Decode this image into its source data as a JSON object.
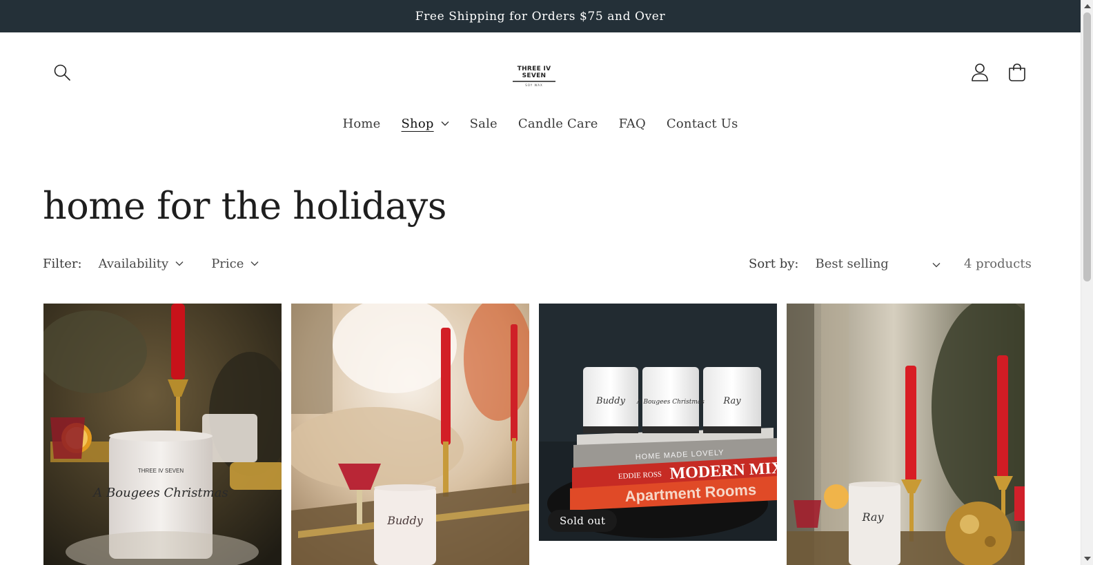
{
  "announcement": {
    "text": "Free Shipping for Orders $75 and Over",
    "bg_color": "#243038"
  },
  "header": {
    "logo": {
      "brand": "THREE IV SEVEN",
      "tagline": "SOY WAX"
    },
    "icons": {
      "search": "search-icon",
      "account": "user-icon",
      "cart": "cart-icon"
    }
  },
  "nav": {
    "items": [
      {
        "label": "Home",
        "active": false,
        "has_dropdown": false
      },
      {
        "label": "Shop",
        "active": true,
        "has_dropdown": true
      },
      {
        "label": "Sale",
        "active": false,
        "has_dropdown": false
      },
      {
        "label": "Candle Care",
        "active": false,
        "has_dropdown": false
      },
      {
        "label": "FAQ",
        "active": false,
        "has_dropdown": false
      },
      {
        "label": "Contact Us",
        "active": false,
        "has_dropdown": false
      }
    ]
  },
  "collection": {
    "title": "home for the holidays"
  },
  "filters": {
    "label": "Filter:",
    "availability": "Availability",
    "price": "Price"
  },
  "sort": {
    "label": "Sort by:",
    "selected": "Best selling"
  },
  "product_count": "4 products",
  "products": [
    {
      "image_alt": "A Bougees Christmas candle on holiday table",
      "label_script": "A Bougees Christmas",
      "sold_out": false
    },
    {
      "image_alt": "Buddy candle on mirrored tray",
      "label_script": "Buddy",
      "sold_out": false
    },
    {
      "image_alt": "Three candles on stack of books",
      "label_script": "Buddy / A Bougees Christmas / Ray",
      "sold_out": true,
      "badge": "Sold out"
    },
    {
      "image_alt": "Ray candle with red taper candles",
      "label_script": "Ray",
      "sold_out": false
    }
  ],
  "book_spines": [
    "HOME MADE LOVELY",
    "EDDIE ROSS",
    "MODERN MIX",
    "Apartment Rooms"
  ]
}
